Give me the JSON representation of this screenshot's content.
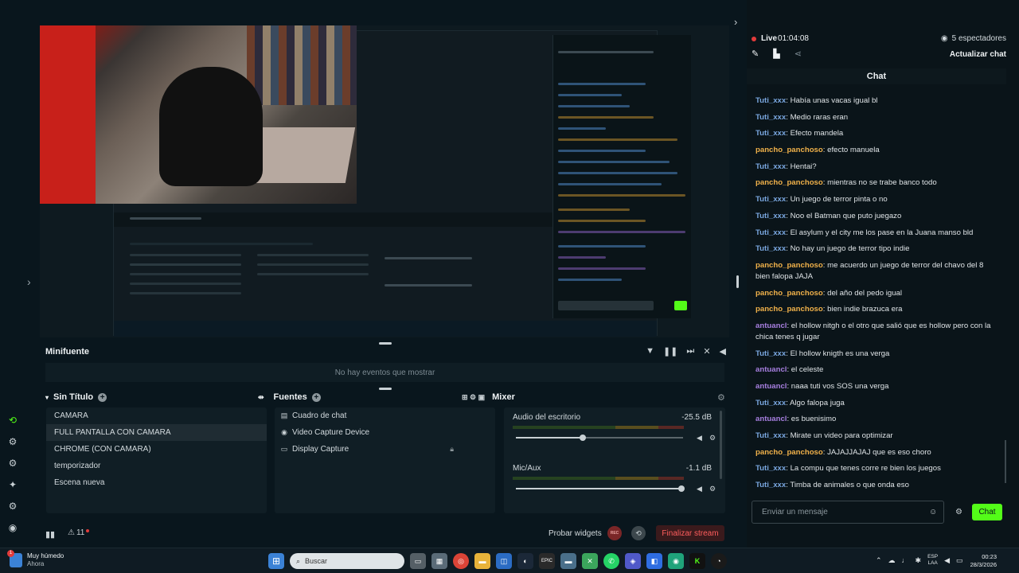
{
  "window_controls": [
    "—",
    "☐",
    "✕"
  ],
  "preview": {
    "mini_title": "Minifuente",
    "mini_empty": "No hay eventos que mostrar"
  },
  "minifuente": {
    "title": "Minifuente",
    "empty_text": "No hay eventos que mostrar"
  },
  "scenes": {
    "title": "Sin Título",
    "items": [
      "CAMARA",
      "FULL PANTALLA CON CAMARA",
      "CHROME (CON CAMARA)",
      "temporizador",
      "Escena nueva"
    ],
    "active_index": 1
  },
  "sources": {
    "title": "Fuentes",
    "items": [
      {
        "label": "Cuadro de chat",
        "icon": "chat-icon"
      },
      {
        "label": "Video Capture Device",
        "icon": "webcam-icon"
      },
      {
        "label": "Display Capture",
        "icon": "monitor-icon"
      }
    ]
  },
  "mixer": {
    "title": "Mixer",
    "channels": [
      {
        "name": "Audio del escritorio",
        "db": "-25.5 dB",
        "level": 0.4
      },
      {
        "name": "Mic/Aux",
        "db": "-1.1 dB",
        "level": 0.99
      }
    ]
  },
  "bottombar": {
    "alert_count": "11",
    "test_widgets": "Probar widgets",
    "rec": "REC",
    "end_stream": "Finalizar stream"
  },
  "chat": {
    "live_label": "Live",
    "live_time": "01:04:08",
    "viewers": "5 espectadores",
    "update_chat": "Actualizar chat",
    "header": "Chat",
    "input_placeholder": "Enviar un mensaje",
    "send_label": "Chat",
    "messages": [
      {
        "user": "Tuti_xxx",
        "text": "Había unas vacas igual bl",
        "color": "#7aa7e0"
      },
      {
        "user": "Tuti_xxx",
        "text": "Medio raras eran",
        "color": "#7aa7e0"
      },
      {
        "user": "Tuti_xxx",
        "text": "Efecto mandela",
        "color": "#7aa7e0"
      },
      {
        "user": "pancho_panchoso",
        "text": "efecto manuela",
        "color": "#f0b14a"
      },
      {
        "user": "Tuti_xxx",
        "text": "Hentai?",
        "color": "#7aa7e0"
      },
      {
        "user": "pancho_panchoso",
        "text": "mientras no se trabe banco todo",
        "color": "#f0b14a"
      },
      {
        "user": "Tuti_xxx",
        "text": "Un juego de terror pinta o no",
        "color": "#7aa7e0"
      },
      {
        "user": "Tuti_xxx",
        "text": "Noo el Batman que puto juegazo",
        "color": "#7aa7e0"
      },
      {
        "user": "Tuti_xxx",
        "text": "El asylum y el city me los pase en la Juana manso bld",
        "color": "#7aa7e0"
      },
      {
        "user": "Tuti_xxx",
        "text": "No hay un juego de terror tipo indie",
        "color": "#7aa7e0"
      },
      {
        "user": "pancho_panchoso",
        "text": "me acuerdo un juego de terror del chavo del 8 bien falopa JAJA",
        "color": "#f0b14a"
      },
      {
        "user": "pancho_panchoso",
        "text": "del año del pedo igual",
        "color": "#f0b14a"
      },
      {
        "user": "pancho_panchoso",
        "text": "bien indie brazuca era",
        "color": "#f0b14a"
      },
      {
        "user": "antuancl",
        "text": "el hollow nitgh o el otro que salió que es hollow pero con la chica tenes q jugar",
        "color": "#a77fe0"
      },
      {
        "user": "Tuti_xxx",
        "text": "El hollow knigth es una verga",
        "color": "#7aa7e0"
      },
      {
        "user": "antuancl",
        "text": "el celeste",
        "color": "#a77fe0"
      },
      {
        "user": "antuancl",
        "text": "naaa tuti vos SOS una verga",
        "color": "#a77fe0"
      },
      {
        "user": "Tuti_xxx",
        "text": "Algo falopa juga",
        "color": "#7aa7e0"
      },
      {
        "user": "antuancl",
        "text": "es buenisimo",
        "color": "#a77fe0"
      },
      {
        "user": "Tuti_xxx",
        "text": "Mirate un video para optimizar",
        "color": "#7aa7e0"
      },
      {
        "user": "pancho_panchoso",
        "text": "JAJAJJAJAJ que es eso choro",
        "color": "#f0b14a"
      },
      {
        "user": "Tuti_xxx",
        "text": "La compu que tenes corre re bien los juegos",
        "color": "#7aa7e0"
      },
      {
        "user": "Tuti_xxx",
        "text": "Timba de animales o que onda eso",
        "color": "#7aa7e0"
      }
    ]
  },
  "taskbar": {
    "weather_title": "Muy húmedo",
    "weather_sub": "Ahora",
    "weather_badge": "1",
    "search_placeholder": "Buscar",
    "lang_top": "ESP",
    "lang_bottom": "LAA",
    "time": "00:23",
    "date": "28/3/2026"
  },
  "colors": {
    "accent": "#53fc18",
    "live": "#e23b3b",
    "end_stream": "#ff5d5d"
  }
}
